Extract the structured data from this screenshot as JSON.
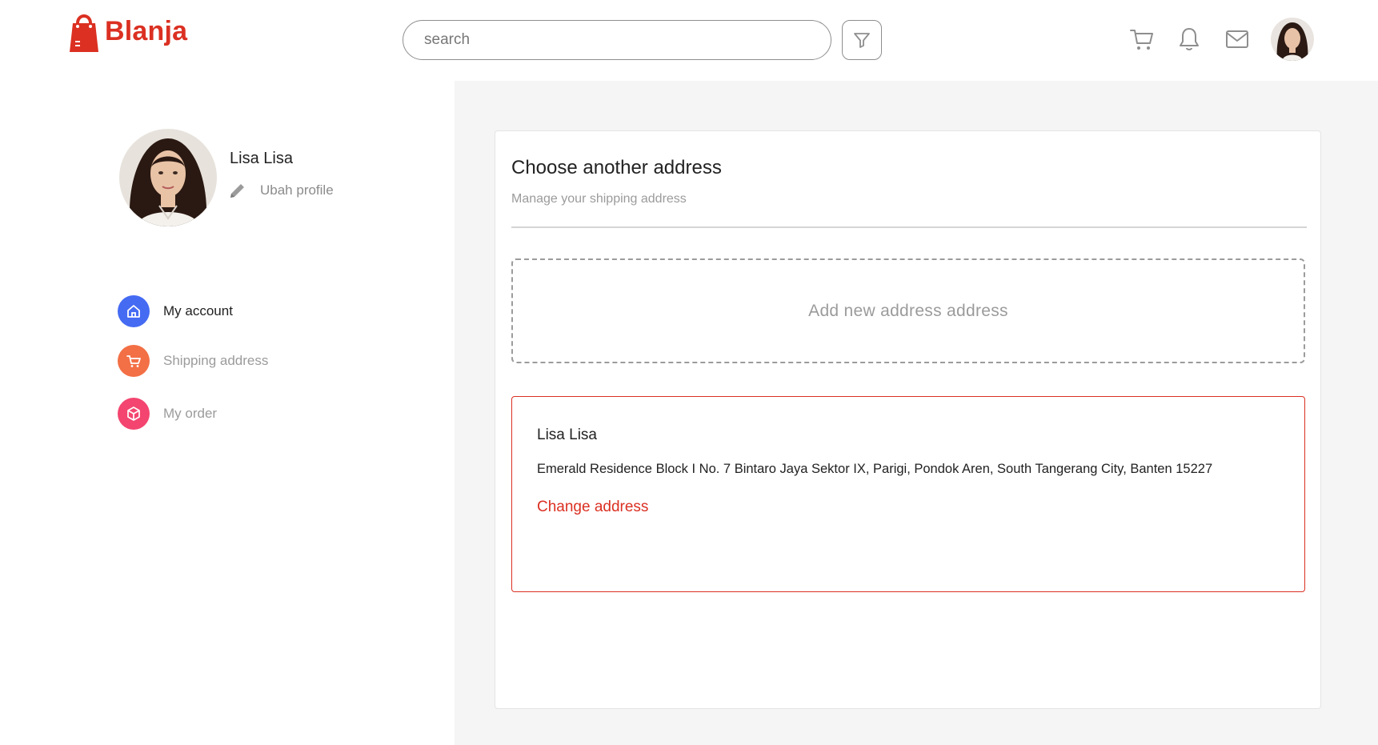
{
  "brand": {
    "name": "Blanja",
    "color": "#db3022"
  },
  "header": {
    "search_placeholder": "search",
    "icons": [
      "filter-icon",
      "cart-icon",
      "bell-icon",
      "mail-icon"
    ]
  },
  "profile": {
    "name": "Lisa Lisa",
    "edit_label": "Ubah profile"
  },
  "sidebar": {
    "items": [
      {
        "label": "My account",
        "icon": "home-icon",
        "color": "#456bf3",
        "active": true
      },
      {
        "label": "Shipping address",
        "icon": "cart-icon",
        "color": "#f36f45",
        "active": false
      },
      {
        "label": "My order",
        "icon": "package-icon",
        "color": "#f3456f",
        "active": false
      }
    ]
  },
  "main": {
    "title": "Choose another address",
    "subtitle": "Manage your shipping address",
    "add_address_label": "Add new address address",
    "address": {
      "name": "Lisa Lisa",
      "full": "Emerald Residence Block I No. 7 Bintaro Jaya Sektor IX, Parigi, Pondok Aren, South Tangerang City, Banten 15227",
      "change_label": "Change address"
    }
  }
}
